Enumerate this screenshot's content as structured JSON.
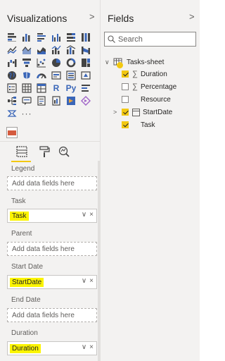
{
  "visualizations": {
    "title": "Visualizations",
    "collapse_icon": "chevron-right-icon",
    "visual_icons": [
      "stacked-bar-chart-icon",
      "stacked-column-chart-icon",
      "clustered-bar-chart-icon",
      "clustered-column-chart-icon",
      "100-percent-bar-chart-icon",
      "100-percent-column-chart-icon",
      "line-chart-icon",
      "area-chart-icon",
      "stacked-area-chart-icon",
      "line-and-column-chart-icon",
      "line-and-stacked-column-chart-icon",
      "ribbon-chart-icon",
      "waterfall-chart-icon",
      "funnel-chart-icon",
      "scatter-chart-icon",
      "pie-chart-icon",
      "donut-chart-icon",
      "treemap-icon",
      "map-icon",
      "filled-map-icon",
      "gauge-icon",
      "card-icon",
      "multi-row-card-icon",
      "kpi-icon",
      "slicer-icon",
      "table-icon",
      "matrix-icon",
      "r-visual-icon",
      "python-visual-icon",
      "key-influencers-icon",
      "decomposition-tree-icon",
      "qa-icon",
      "smart-narrative-icon",
      "paginated-report-icon",
      "power-apps-icon",
      "power-automate-icon",
      "arcgis-map-icon",
      "more-visuals-icon"
    ],
    "r_label": "R",
    "py_label": "Py",
    "more_label": "···",
    "selected_custom_visual_icon": "gantt-custom-visual-icon",
    "tabs": {
      "fields_tab_icon": "fields-tab-icon",
      "format_tab_icon": "paint-roller-icon",
      "analytics_tab_icon": "analytics-magnifier-icon"
    },
    "wells": [
      {
        "label": "Legend",
        "placeholder": "Add data fields here",
        "value": ""
      },
      {
        "label": "Task",
        "placeholder": "",
        "value": "Task"
      },
      {
        "label": "Parent",
        "placeholder": "Add data fields here",
        "value": ""
      },
      {
        "label": "Start Date",
        "placeholder": "",
        "value": "StartDate"
      },
      {
        "label": "End Date",
        "placeholder": "Add data fields here",
        "value": ""
      },
      {
        "label": "Duration",
        "placeholder": "",
        "value": "Duration"
      }
    ],
    "well_actions": {
      "expand": "∨",
      "remove": "×"
    }
  },
  "fields": {
    "title": "Fields",
    "collapse_icon": "chevron-right-icon",
    "search_placeholder": "Search",
    "table": {
      "expand_glyph": "∨",
      "name": "Tasks-sheet",
      "items": [
        {
          "name": "Duration",
          "checked": true,
          "sigma": true
        },
        {
          "name": "Percentage",
          "checked": false,
          "sigma": true
        },
        {
          "name": "Resource",
          "checked": false,
          "sigma": false
        },
        {
          "name": "StartDate",
          "checked": true,
          "sigma": false,
          "expandable": true
        },
        {
          "name": "Task",
          "checked": true,
          "sigma": false
        }
      ],
      "expand_glyph_child": ">",
      "sigma_glyph": "∑"
    }
  },
  "colors": {
    "pane_bg": "#f3f2f1",
    "accent_yellow": "#f2c811",
    "highlight_yellow": "#fbf402",
    "visual_blue": "#3a66b8"
  }
}
